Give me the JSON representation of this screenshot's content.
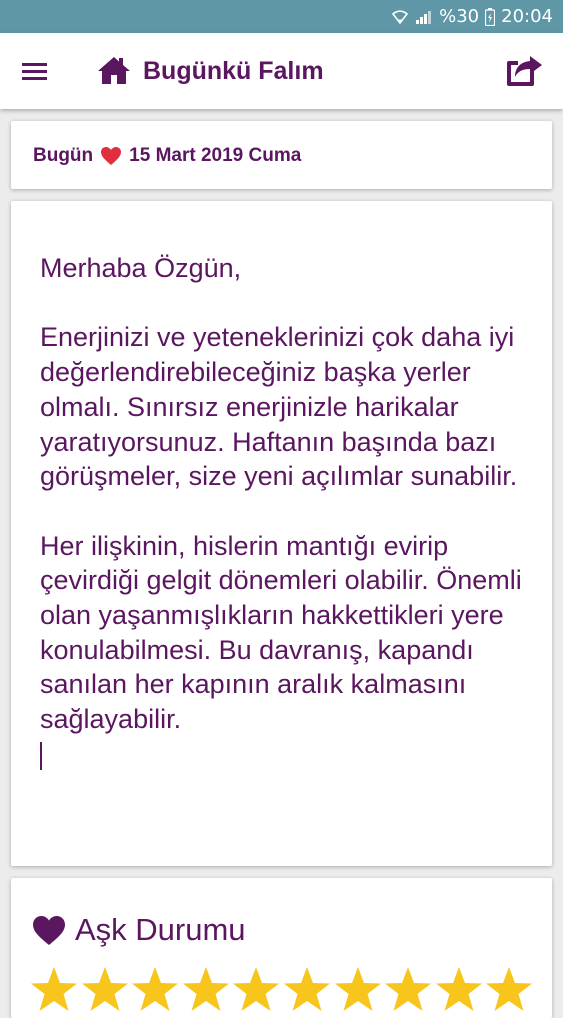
{
  "status_bar": {
    "battery": "%30",
    "time": "20:04",
    "icons": [
      "wifi-icon",
      "signal-icon",
      "battery-charging-icon"
    ]
  },
  "app_bar": {
    "title": "Bugünkü Falım",
    "icons": [
      "menu-icon",
      "home-icon",
      "share-icon"
    ]
  },
  "date_card": {
    "prefix": "Bugün",
    "date": "15 Mart 2019 Cuma"
  },
  "fortune": {
    "greeting": "Merhaba Özgün,",
    "paragraph1": "Enerjinizi ve yeteneklerinizi çok daha iyi değerlendirebileceğiniz başka yerler olmalı. Sınırsız enerjinizle harikalar yaratıyorsunuz. Haftanın başında bazı görüşmeler, size yeni açılımlar sunabilir.",
    "paragraph2": "Her ilişkinin, hislerin mantığı evirip çevirdiği gelgit dönemleri olabilir. Önemli olan yaşanmışlıkların hakkettikleri yere konulabilmesi. Bu davranış, kapandı sanılan her kapının aralık kalmasını sağlayabilir."
  },
  "love_status": {
    "title": "Aşk Durumu",
    "rating": 10,
    "max": 10
  },
  "colors": {
    "primary": "#5b1660",
    "status_bar": "#5f97a7",
    "heart_red": "#e0303f",
    "star": "#f7c51b"
  }
}
